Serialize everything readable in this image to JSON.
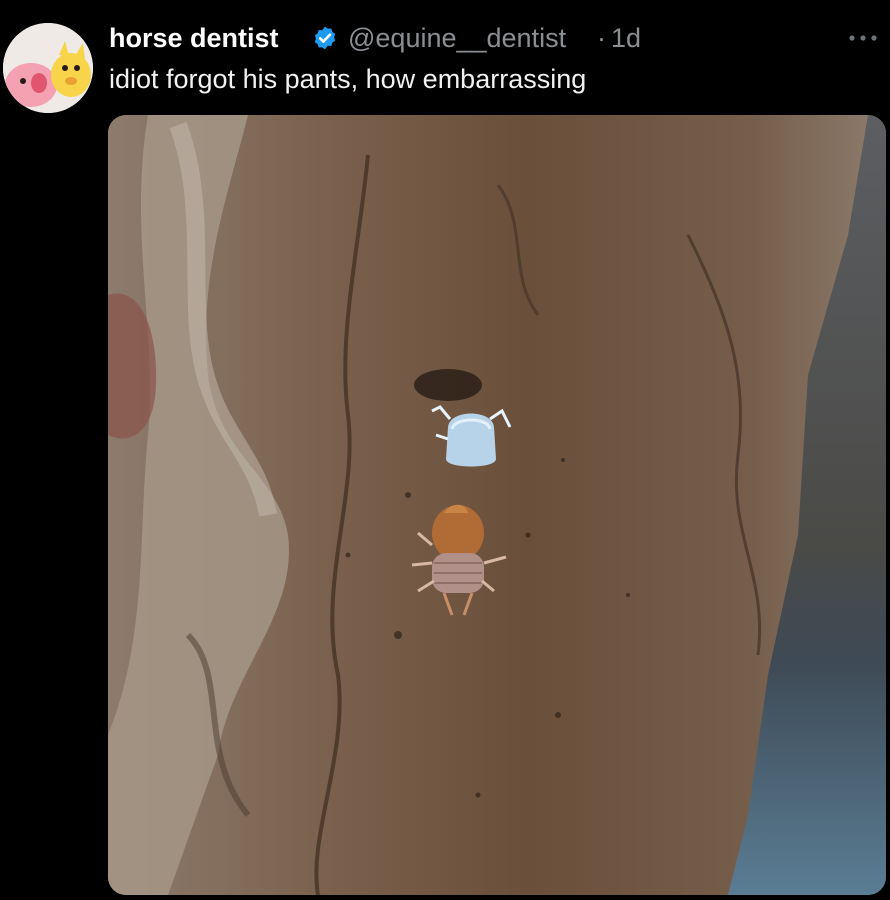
{
  "tweet": {
    "display_name": "horse dentist",
    "verified_icon": "verified-badge-icon",
    "handle": "@equine__dentist",
    "separator": "·",
    "timestamp": "1d",
    "more_icon": "more-options-icon",
    "text": "idiot forgot his pants, how embarrassing",
    "avatar_icon": "avatar-cartoon-icon",
    "media_icon": "photo-bark-isopods"
  },
  "colors": {
    "background": "#000000",
    "name": "#ffffff",
    "secondary": "#8b8f94",
    "verified": "#1d9bf0"
  }
}
